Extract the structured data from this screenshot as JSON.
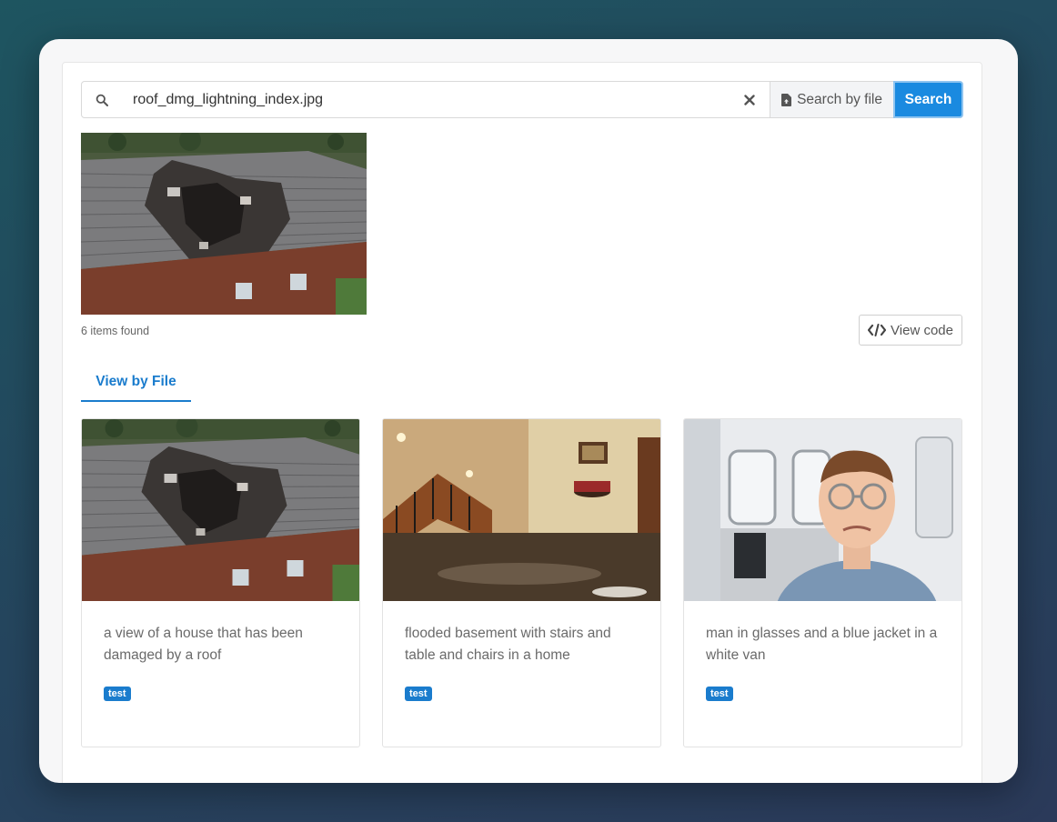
{
  "search": {
    "value": "roof_dmg_lightning_index.jpg",
    "by_file_label": "Search by file",
    "button_label": "Search"
  },
  "results": {
    "count_text": "6 items found",
    "view_code_label": "View code"
  },
  "tabs": [
    {
      "label": "View by File",
      "active": true
    }
  ],
  "cards": [
    {
      "caption": "a view of a house that has been damaged by a roof",
      "tag": "test"
    },
    {
      "caption": "flooded basement with stairs and table and chairs in a home",
      "tag": "test"
    },
    {
      "caption": "man in glasses and a blue jacket in a white van",
      "tag": "test"
    }
  ],
  "colors": {
    "accent": "#1a8ae0",
    "tab_active": "#1a7ccd"
  }
}
